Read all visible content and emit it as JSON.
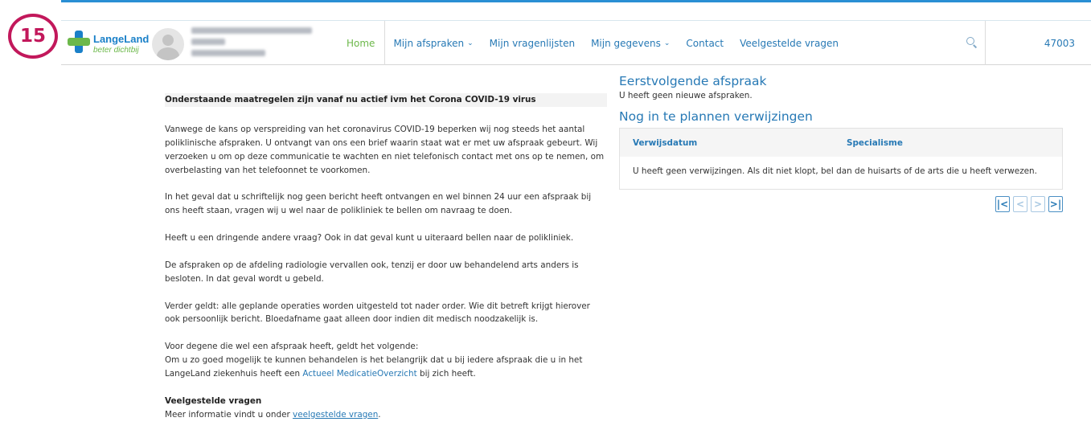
{
  "step": "15",
  "brand": {
    "name": "LangeLand",
    "tagline": "beter dichtbij"
  },
  "user": {
    "id": "47003"
  },
  "nav": {
    "home": "Home",
    "appointments": "Mijn afspraken",
    "questionnaires": "Mijn vragenlijsten",
    "details": "Mijn gegevens",
    "contact": "Contact",
    "faq": "Veelgestelde vragen"
  },
  "icons": {
    "search": "search-icon",
    "chevron": "chevron-down-icon",
    "avatar": "user-avatar-icon"
  },
  "colors": {
    "accent": "#2779b5",
    "brand_green": "#6cb84a",
    "badge": "#c2185b"
  },
  "notice": {
    "title": "Onderstaande maatregelen zijn vanaf nu actief ivm het Corona COVID-19 virus",
    "p1": "Vanwege de kans op verspreiding van het coronavirus COVID-19 beperken wij nog steeds het aantal poliklinische afspraken. U ontvangt van ons een brief waarin staat wat er met uw afspraak gebeurt. Wij verzoeken u om op deze communicatie te wachten en niet telefonisch contact met ons op te nemen, om overbelasting van het telefoonnet te voorkomen.",
    "p2": "In het geval dat u schriftelijk nog geen bericht heeft ontvangen en wel binnen 24 uur een afspraak bij ons heeft staan, vragen wij u wel naar de polikliniek te bellen om navraag te doen.",
    "p3": "Heeft u een dringende andere vraag? Ook in dat geval kunt u uiteraard bellen naar de polikliniek.",
    "p4": "De afspraken op de afdeling radiologie vervallen ook, tenzij er door uw behandelend arts anders is besloten. In dat geval wordt u gebeld.",
    "p5": "Verder geldt: alle geplande operaties worden uitgesteld tot nader order. Wie dit betreft krijgt hierover ook persoonlijk bericht. Bloedafname gaat alleen door indien dit medisch noodzakelijk is.",
    "p6_line1": "Voor degene die wel een afspraak heeft, geldt het volgende:",
    "p6_line2": "Om u zo goed mogelijk te kunnen behandelen is het belangrijk dat u bij iedere afspraak die u in het LangeLand ziekenhuis heeft een",
    "p6_link": "Actueel MedicatieOverzicht",
    "p6_end": "bij zich heeft.",
    "faq_title": "Veelgestelde vragen",
    "faq_text": "Meer informatie vindt u onder",
    "faq_link": "veelgestelde vragen",
    "faq_end": "."
  },
  "next_appointment": {
    "title": "Eerstvolgende afspraak",
    "empty": "U heeft geen nieuwe afspraken."
  },
  "referrals": {
    "title": "Nog in te plannen verwijzingen",
    "columns": [
      "Verwijsdatum",
      "Specialisme"
    ],
    "empty": "U heeft geen verwijzingen. Als dit niet klopt, bel dan de huisarts of de arts die u heeft verwezen."
  },
  "pager": {
    "first": "|<",
    "prev": "<",
    "next": ">",
    "last": ">|"
  }
}
